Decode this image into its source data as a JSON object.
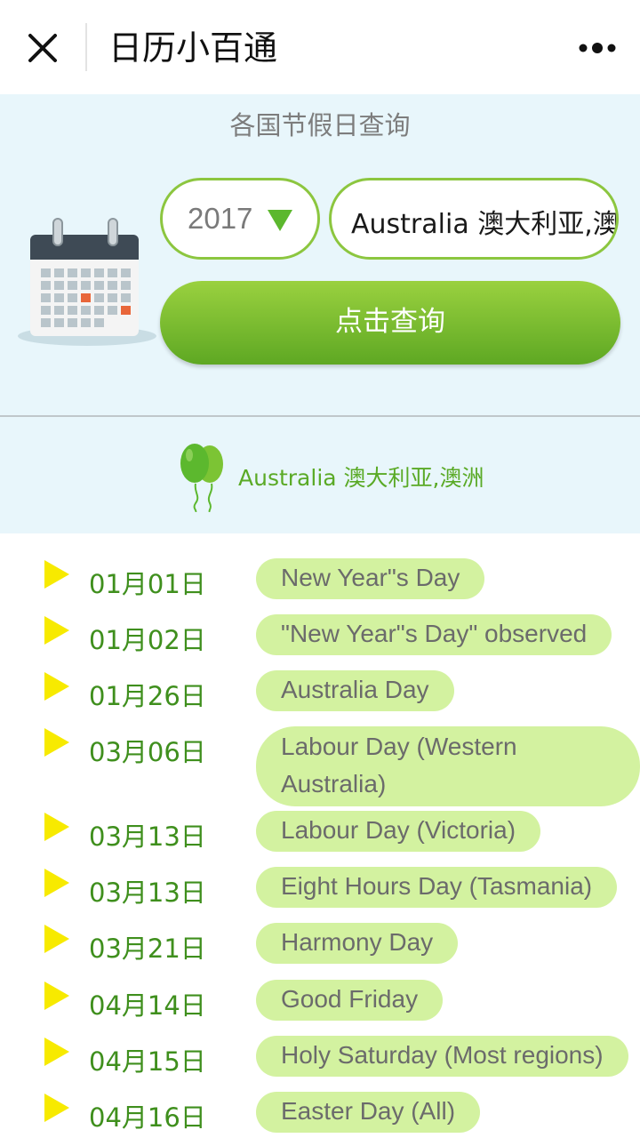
{
  "header": {
    "title": "日历小百通"
  },
  "search": {
    "section_title": "各国节假日查询",
    "year": "2017",
    "country": "Australia 澳大利亚,澳",
    "button_label": "点击查询"
  },
  "result": {
    "country": "Australia 澳大利亚,澳洲"
  },
  "colors": {
    "accent_green": "#5cb82e",
    "panel_bg": "#e8f6fb",
    "pill_bg": "#d3f2a0",
    "bullet_yellow": "#f7ea00"
  },
  "holidays": [
    {
      "date": "01月01日",
      "name": "New Year\"s Day"
    },
    {
      "date": "01月02日",
      "name": "\"New Year\"s Day\" observed"
    },
    {
      "date": "01月26日",
      "name": "Australia Day"
    },
    {
      "date": "03月06日",
      "name": "Labour Day (Western Australia)"
    },
    {
      "date": "03月13日",
      "name": "Labour Day (Victoria)"
    },
    {
      "date": "03月13日",
      "name": "Eight Hours Day (Tasmania)"
    },
    {
      "date": "03月21日",
      "name": "Harmony Day"
    },
    {
      "date": "04月14日",
      "name": "Good Friday"
    },
    {
      "date": "04月15日",
      "name": "Holy Saturday (Most regions)"
    },
    {
      "date": "04月16日",
      "name": "Easter Day (All)"
    }
  ]
}
